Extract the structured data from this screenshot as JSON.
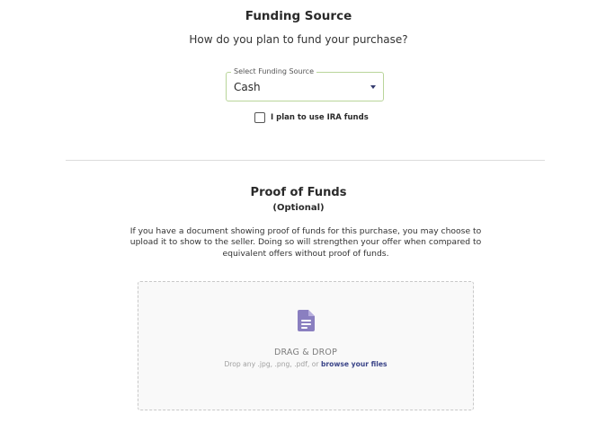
{
  "funding": {
    "title": "Funding Source",
    "question": "How do you plan to fund your purchase?",
    "select_label": "Select Funding Source",
    "select_value": "Cash",
    "ira_checkbox_label": "I plan to use IRA funds",
    "ira_checked": false
  },
  "proof": {
    "title": "Proof of Funds",
    "subtitle": "(Optional)",
    "description": "If you have a document showing proof of funds for this purchase, you may choose to upload it to show to the seller. Doing so will strengthen your offer when compared to equivalent offers without proof of funds.",
    "dropzone": {
      "icon": "file-document-icon",
      "heading": "DRAG & DROP",
      "hint_prefix": "Drop any .jpg, .png, .pdf, or ",
      "browse_link": "browse your files"
    }
  },
  "colors": {
    "select_border": "#b9d59a",
    "caret": "#333a6e",
    "icon": "#8a7fc0",
    "link": "#3a4488"
  }
}
